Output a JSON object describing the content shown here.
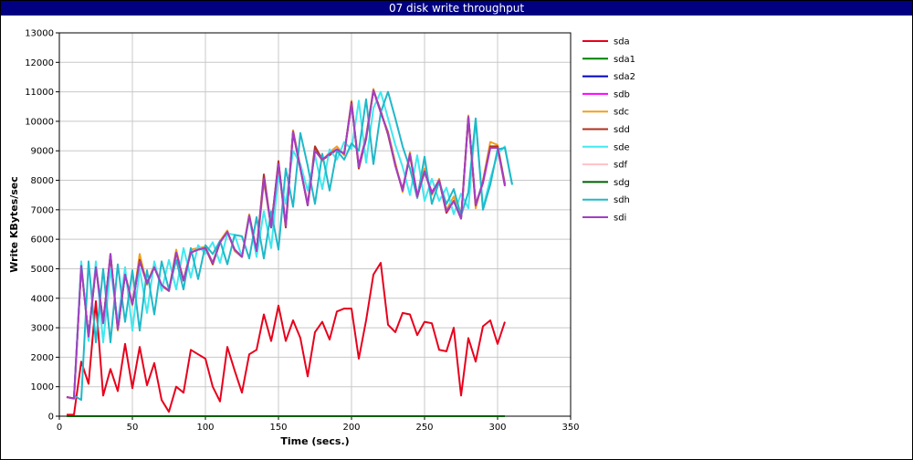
{
  "window": {
    "title": "07 disk write throughput"
  },
  "chart_data": {
    "type": "line",
    "title": "07 disk write throughput",
    "xlabel": "Time (secs.)",
    "ylabel": "Write KBytes/sec",
    "xlim": [
      0,
      350
    ],
    "ylim": [
      0,
      13000
    ],
    "xticks": [
      0,
      50,
      100,
      150,
      200,
      250,
      300,
      350
    ],
    "yticks": [
      0,
      1000,
      2000,
      3000,
      4000,
      5000,
      6000,
      7000,
      8000,
      9000,
      10000,
      11000,
      12000,
      13000
    ],
    "grid": true,
    "legend_position": "right",
    "series": [
      {
        "name": "sda",
        "color": "#e8001c",
        "x": [
          5,
          10,
          15,
          20,
          25,
          30,
          35,
          40,
          45,
          50,
          55,
          60,
          65,
          70,
          75,
          80,
          85,
          90,
          95,
          100,
          105,
          110,
          115,
          120,
          125,
          130,
          135,
          140,
          145,
          150,
          155,
          160,
          165,
          170,
          175,
          180,
          185,
          190,
          195,
          200,
          205,
          210,
          215,
          220,
          225,
          230,
          235,
          240,
          245,
          250,
          255,
          260,
          265,
          270,
          275,
          280,
          285,
          290,
          295,
          300,
          305
        ],
        "values": [
          50,
          50,
          1850,
          1100,
          3900,
          700,
          1600,
          850,
          2450,
          950,
          2350,
          1050,
          1800,
          550,
          150,
          1000,
          800,
          2250,
          2100,
          1950,
          1000,
          500,
          2350,
          1550,
          800,
          2100,
          2250,
          3450,
          2550,
          3750,
          2550,
          3250,
          2650,
          1350,
          2850,
          3200,
          2600,
          3550,
          3650,
          3650,
          1950,
          3250,
          4800,
          5200,
          3100,
          2850,
          3500,
          3450,
          2750,
          3200,
          3150,
          2250,
          2200,
          3000,
          700,
          2650,
          1850,
          3050,
          3250,
          2450,
          3200
        ]
      },
      {
        "name": "sda1",
        "color": "#008000",
        "x": [
          5,
          305
        ],
        "values": [
          0,
          0
        ]
      },
      {
        "name": "sda2",
        "color": "#0000c0",
        "x": [
          5,
          305
        ],
        "values": [
          0,
          0
        ]
      },
      {
        "name": "sdb",
        "color": "#ff00ff",
        "x": [
          5,
          10,
          15,
          20,
          25,
          30,
          35,
          40,
          45,
          50,
          55,
          60,
          65,
          70,
          75,
          80,
          85,
          90,
          95,
          100,
          105,
          110,
          115,
          120,
          125,
          130,
          135,
          140,
          145,
          150,
          155,
          160,
          165,
          170,
          175,
          180,
          185,
          190,
          195,
          200,
          205,
          210,
          215,
          220,
          225,
          230,
          235,
          240,
          245,
          250,
          255,
          260,
          265,
          270,
          275,
          280,
          285,
          290,
          295,
          300,
          305
        ],
        "values": [
          650,
          600,
          5100,
          2700,
          5050,
          3200,
          5500,
          2950,
          4800,
          3800,
          5250,
          4550,
          5050,
          4450,
          4250,
          5550,
          4600,
          5550,
          5650,
          5700,
          5200,
          5900,
          6250,
          5650,
          5400,
          6800,
          5600,
          8100,
          6400,
          8600,
          6500,
          9600,
          8400,
          7200,
          9000,
          8700,
          8900,
          9050,
          8900,
          10600,
          8500,
          9500,
          11050,
          10300,
          9600,
          8500,
          7700,
          8900,
          7500,
          8300,
          7600,
          8000,
          6900,
          7300,
          6700,
          10150,
          7200,
          7900,
          9100,
          9100,
          7800
        ]
      },
      {
        "name": "sdc",
        "color": "#f0a020",
        "x": [
          5,
          10,
          15,
          20,
          25,
          30,
          35,
          40,
          45,
          50,
          55,
          60,
          65,
          70,
          75,
          80,
          85,
          90,
          95,
          100,
          105,
          110,
          115,
          120,
          125,
          130,
          135,
          140,
          145,
          150,
          155,
          160,
          165,
          170,
          175,
          180,
          185,
          190,
          195,
          200,
          205,
          210,
          215,
          220,
          225,
          230,
          235,
          240,
          245,
          250,
          255,
          260,
          265,
          270,
          275,
          280,
          285,
          290,
          295,
          300,
          305
        ],
        "values": [
          650,
          600,
          5100,
          2650,
          5050,
          3150,
          5500,
          2900,
          4850,
          3750,
          5500,
          4450,
          5150,
          4400,
          4250,
          5650,
          4600,
          5650,
          5700,
          5750,
          5200,
          5950,
          6300,
          5600,
          5400,
          6850,
          5550,
          7950,
          6450,
          8550,
          6400,
          9700,
          8450,
          7150,
          9050,
          8650,
          8950,
          9150,
          8850,
          10700,
          8400,
          9500,
          11100,
          10300,
          9650,
          8600,
          7600,
          8950,
          7400,
          8400,
          7500,
          8050,
          7000,
          7450,
          6700,
          10200,
          7050,
          8000,
          9300,
          9200,
          7900
        ]
      },
      {
        "name": "sdd",
        "color": "#b03020",
        "x": [
          5,
          10,
          15,
          20,
          25,
          30,
          35,
          40,
          45,
          50,
          55,
          60,
          65,
          70,
          75,
          80,
          85,
          90,
          95,
          100,
          105,
          110,
          115,
          120,
          125,
          130,
          135,
          140,
          145,
          150,
          155,
          160,
          165,
          170,
          175,
          180,
          185,
          190,
          195,
          200,
          205,
          210,
          215,
          220,
          225,
          230,
          235,
          240,
          245,
          250,
          255,
          260,
          265,
          270,
          275,
          280,
          285,
          290,
          295,
          300,
          305
        ],
        "values": [
          650,
          600,
          5100,
          2700,
          5100,
          3200,
          5450,
          2950,
          4800,
          3800,
          5300,
          4500,
          5050,
          4450,
          4250,
          5550,
          4600,
          5550,
          5650,
          5700,
          5150,
          5900,
          6250,
          5650,
          5400,
          6800,
          5600,
          8200,
          6400,
          8650,
          6400,
          9650,
          8400,
          7150,
          9150,
          8700,
          8850,
          9050,
          8900,
          10650,
          8400,
          9400,
          11050,
          10350,
          9550,
          8500,
          7650,
          8850,
          7450,
          8300,
          7550,
          8000,
          6900,
          7300,
          6700,
          10150,
          7150,
          7950,
          9150,
          9150,
          7850
        ]
      },
      {
        "name": "sde",
        "color": "#40e8f0",
        "x": [
          10,
          15,
          20,
          25,
          30,
          35,
          40,
          45,
          50,
          55,
          60,
          65,
          70,
          75,
          80,
          85,
          90,
          95,
          100,
          105,
          110,
          115,
          120,
          125,
          130,
          135,
          140,
          145,
          150,
          155,
          160,
          165,
          170,
          175,
          180,
          185,
          190,
          195,
          200,
          205,
          210,
          215,
          220,
          225,
          230,
          235,
          240,
          245,
          250,
          255,
          260,
          265,
          270,
          275,
          280,
          285,
          290,
          295,
          300,
          305,
          310
        ],
        "values": [
          600,
          5250,
          2550,
          5250,
          2500,
          5000,
          3200,
          5050,
          2900,
          5000,
          3500,
          5250,
          4250,
          5300,
          4300,
          5700,
          4700,
          5800,
          5500,
          5900,
          5200,
          6200,
          6150,
          5400,
          6750,
          5400,
          6950,
          5700,
          8150,
          7200,
          9000,
          8550,
          7650,
          8850,
          7700,
          9050,
          8700,
          9300,
          9050,
          10700,
          8600,
          10450,
          11000,
          10100,
          9200,
          8450,
          7500,
          8850,
          7300,
          8050,
          7300,
          7750,
          6850,
          7550,
          7050,
          10050,
          7050,
          8050,
          8900,
          9150,
          7850
        ]
      },
      {
        "name": "sdf",
        "color": "#ffc0c8",
        "x": [
          5,
          305
        ],
        "values": [
          0,
          0
        ]
      },
      {
        "name": "sdg",
        "color": "#006000",
        "x": [
          5,
          305
        ],
        "values": [
          0,
          0
        ]
      },
      {
        "name": "sdh",
        "color": "#20b8c8",
        "x": [
          10,
          15,
          20,
          25,
          30,
          35,
          40,
          45,
          50,
          55,
          60,
          65,
          70,
          75,
          80,
          85,
          90,
          95,
          100,
          105,
          110,
          115,
          120,
          125,
          130,
          135,
          140,
          145,
          150,
          155,
          160,
          165,
          170,
          175,
          180,
          185,
          190,
          195,
          200,
          205,
          210,
          215,
          220,
          225,
          230,
          235,
          240,
          245,
          250,
          255,
          260,
          265,
          270,
          275,
          280,
          285,
          290,
          295,
          300,
          305,
          310
        ],
        "values": [
          700,
          550,
          5250,
          2500,
          5000,
          2500,
          5150,
          3200,
          4950,
          2900,
          4950,
          3450,
          5250,
          4300,
          5300,
          4300,
          5700,
          4650,
          5800,
          5500,
          5950,
          5150,
          6150,
          6100,
          5350,
          6750,
          5350,
          6950,
          5650,
          8400,
          7100,
          9600,
          8500,
          7200,
          8900,
          7650,
          9000,
          8700,
          9250,
          9000,
          10750,
          8550,
          10300,
          11000,
          10100,
          9150,
          8400,
          7400,
          8800,
          7200,
          7950,
          7200,
          7700,
          6800,
          7600,
          10100,
          7000,
          7850,
          9050,
          9100,
          7850
        ]
      },
      {
        "name": "sdi",
        "color": "#a040c0",
        "x": [
          5,
          10,
          15,
          20,
          25,
          30,
          35,
          40,
          45,
          50,
          55,
          60,
          65,
          70,
          75,
          80,
          85,
          90,
          95,
          100,
          105,
          110,
          115,
          120,
          125,
          130,
          135,
          140,
          145,
          150,
          155,
          160,
          165,
          170,
          175,
          180,
          185,
          190,
          195,
          200,
          205,
          210,
          215,
          220,
          225,
          230,
          235,
          240,
          245,
          250,
          255,
          260,
          265,
          270,
          275,
          280,
          285,
          290,
          295,
          300,
          305
        ],
        "values": [
          650,
          600,
          5100,
          2700,
          5050,
          3150,
          5500,
          2950,
          4800,
          3800,
          5250,
          4500,
          5050,
          4450,
          4250,
          5550,
          4600,
          5550,
          5650,
          5700,
          5200,
          5900,
          6250,
          5650,
          5400,
          6800,
          5600,
          8050,
          6400,
          8550,
          6450,
          9650,
          8400,
          7150,
          9000,
          8700,
          8900,
          9050,
          8900,
          10600,
          8450,
          9450,
          11050,
          10300,
          9600,
          8500,
          7650,
          8900,
          7450,
          8300,
          7550,
          8000,
          6950,
          7300,
          6700,
          10150,
          7150,
          7950,
          9100,
          9100,
          7850
        ]
      }
    ]
  }
}
